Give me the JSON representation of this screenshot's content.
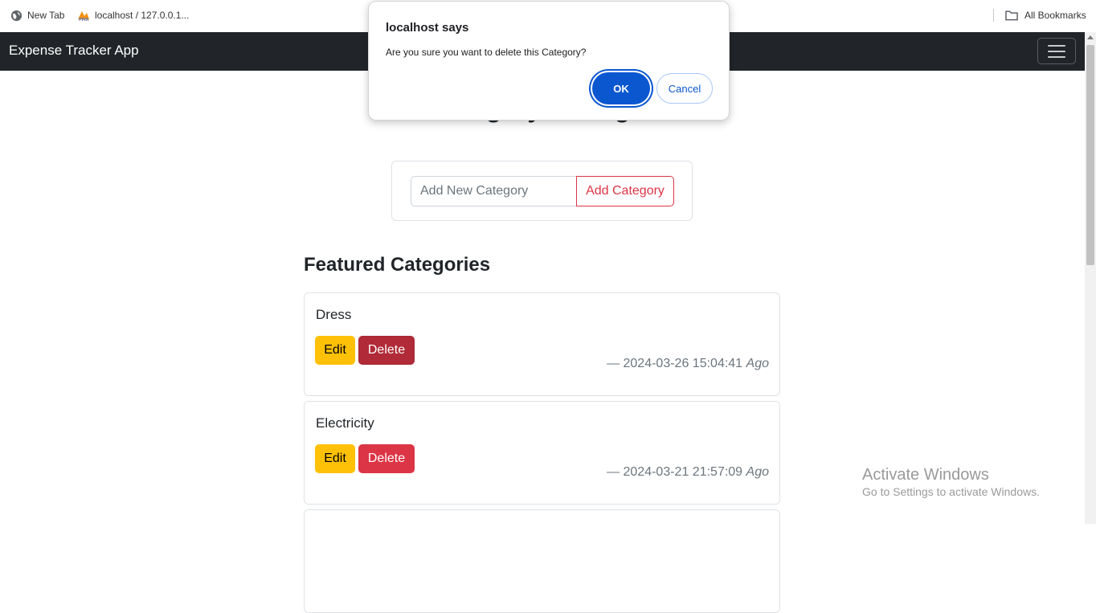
{
  "bookmarks": {
    "items": [
      {
        "label": "New Tab",
        "icon": "globe-icon"
      },
      {
        "label": "localhost / 127.0.0.1...",
        "icon": "phpmyadmin-icon"
      }
    ],
    "all_bookmarks": "All Bookmarks"
  },
  "navbar": {
    "brand": "Expense Tracker App"
  },
  "page": {
    "title": "Category Manager"
  },
  "form": {
    "placeholder": "Add New Category",
    "add_label": "Add Category"
  },
  "section": {
    "title": "Featured Categories"
  },
  "categories": [
    {
      "name": "Dress",
      "edit": "Edit",
      "delete": "Delete",
      "time": "— 2024-03-26 15:04:41",
      "ago": "Ago"
    },
    {
      "name": "Electricity",
      "edit": "Edit",
      "delete": "Delete",
      "time": "— 2024-03-21 21:57:09",
      "ago": "Ago"
    }
  ],
  "dialog": {
    "title": "localhost says",
    "message": "Are you sure you want to delete this Category?",
    "ok": "OK",
    "cancel": "Cancel"
  },
  "watermark": {
    "line1": "Activate Windows",
    "line2": "Go to Settings to activate Windows."
  },
  "colors": {
    "navbar": "#212529",
    "danger": "#dc3545",
    "warning": "#ffc107",
    "dialog_primary": "#0b57d0"
  }
}
